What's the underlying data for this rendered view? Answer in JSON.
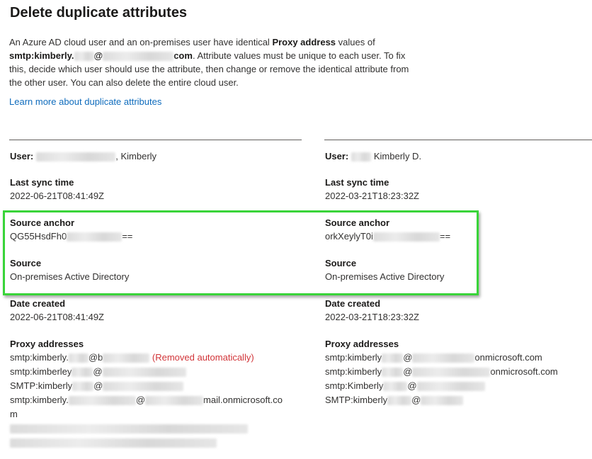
{
  "page": {
    "title": "Delete duplicate attributes",
    "description": {
      "part1": "An Azure AD cloud user and an on-premises user have identical ",
      "bold_attr": "Proxy address",
      "part2": " values of",
      "email_prefix": "smtp:kimberly.",
      "email_mid": "@",
      "email_suffix": "com",
      "part3": ". Attribute values must be unique to each user. To fix this, decide which user should use the attribute, then change or remove the identical attribute from the other user. You can also delete the entire cloud user."
    },
    "learn_more_link": "Learn more about duplicate attributes"
  },
  "left": {
    "user_label": "User:",
    "user_name": ", Kimberly",
    "last_sync_label": "Last sync time",
    "last_sync_value": "2022-06-21T08:41:49Z",
    "source_anchor_label": "Source anchor",
    "source_anchor_prefix": "QG55HsdFh0",
    "source_anchor_suffix": "==",
    "source_label": "Source",
    "source_value": "On-premises Active Directory",
    "date_created_label": "Date created",
    "date_created_value": "2022-06-21T08:41:49Z",
    "proxy_label": "Proxy addresses",
    "proxy": [
      {
        "prefix": "smtp:kimberly.",
        "mid": "@b",
        "suffix": "",
        "note": "(Removed automatically)"
      },
      {
        "prefix": "smtp:kimberley",
        "mid": "@",
        "suffix": "",
        "note": ""
      },
      {
        "prefix": "SMTP:kimberly",
        "mid": "@",
        "suffix": "",
        "note": ""
      },
      {
        "prefix": "smtp:kimberly.",
        "mid": "@",
        "suffix": "mail.onmicrosoft.co",
        "note": ""
      }
    ],
    "proxy_wrap": "m"
  },
  "right": {
    "user_label": "User:",
    "user_name": "Kimberly D.",
    "last_sync_label": "Last sync time",
    "last_sync_value": "2022-03-21T18:23:32Z",
    "source_anchor_label": "Source anchor",
    "source_anchor_prefix": "orkXeylyT0i",
    "source_anchor_suffix": "==",
    "source_label": "Source",
    "source_value": "On-premises Active Directory",
    "date_created_label": "Date created",
    "date_created_value": "2022-03-21T18:23:32Z",
    "proxy_label": "Proxy addresses",
    "proxy": [
      {
        "prefix": "smtp:kimberly",
        "mid": "@",
        "suffix": "onmicrosoft.com"
      },
      {
        "prefix": "smtp:kimberly",
        "mid": "@",
        "suffix": "onmicrosoft.com"
      },
      {
        "prefix": "smtp:Kimberly",
        "mid": "@",
        "suffix": ""
      },
      {
        "prefix": "SMTP:kimberly",
        "mid": "@",
        "suffix": ""
      }
    ]
  },
  "colors": {
    "link": "#0f6cbd",
    "removed_note": "#d13438",
    "highlight": "#39d439"
  }
}
